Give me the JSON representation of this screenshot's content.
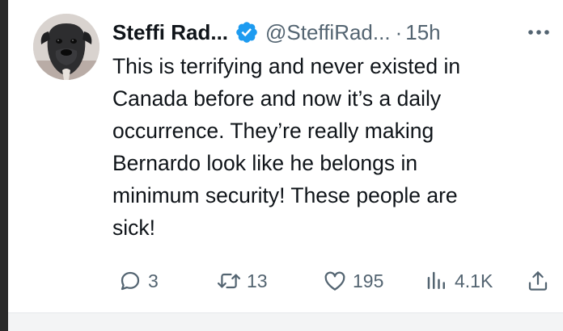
{
  "tweet": {
    "display_name": "Steffi Rad...",
    "handle": "@SteffiRad...",
    "separator": "·",
    "time": "15h",
    "verified": true,
    "text": "This is terrifying and never existed in\nCanada before and now it’s a daily\noccurrence. They’re really making\nBernardo look like he belongs in\nminimum security! These people are\nsick!",
    "icons": {
      "avatar": "dog-avatar",
      "verified": "verified-badge-icon",
      "more": "more-horizontal-icon"
    },
    "colors": {
      "verified": "#1d9bf0",
      "muted": "#536471",
      "text": "#0f1419"
    }
  },
  "actions": {
    "replies": "3",
    "retweets": "13",
    "likes": "195",
    "views": "4.1K",
    "icons": [
      "reply-icon",
      "retweet-icon",
      "like-icon",
      "views-icon",
      "share-icon"
    ]
  }
}
